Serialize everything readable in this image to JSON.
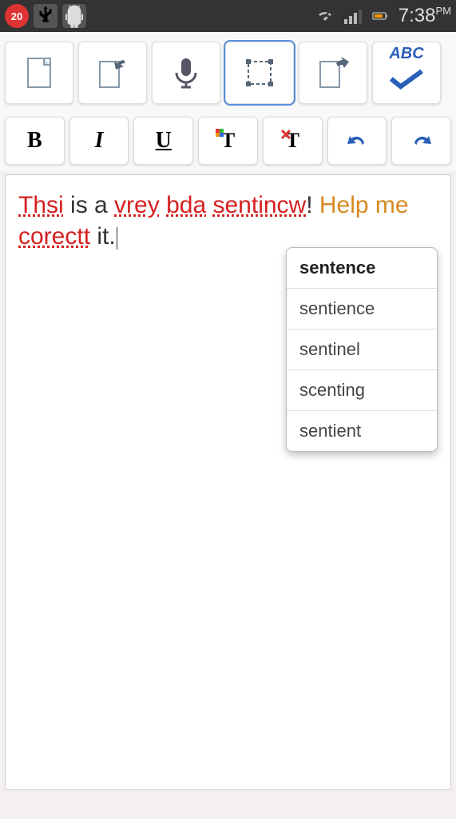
{
  "status_bar": {
    "calendar_day": "20",
    "clock_time": "7:38",
    "clock_ampm": "PM"
  },
  "toolbar1": {
    "new_doc": "new-document",
    "import": "import",
    "voice": "voice-input",
    "select": "selection-mode",
    "export": "export",
    "spellcheck_label": "ABC"
  },
  "toolbar2": {
    "bold": "B",
    "italic": "I",
    "underline": "U",
    "font_color": "T",
    "clear_format": "T",
    "undo": "undo",
    "redo": "redo"
  },
  "document": {
    "segments": [
      {
        "text": "Thsi",
        "cls": "misspell"
      },
      {
        "text": " is a ",
        "cls": ""
      },
      {
        "text": "vrey",
        "cls": "misspell"
      },
      {
        "text": " ",
        "cls": ""
      },
      {
        "text": "bda",
        "cls": "misspell"
      },
      {
        "text": " ",
        "cls": ""
      },
      {
        "text": "sentincw",
        "cls": "misspell"
      },
      {
        "text": "! ",
        "cls": ""
      },
      {
        "text": "Help me ",
        "cls": "grammar"
      },
      {
        "text": "corectt",
        "cls": "misspell"
      },
      {
        "text": " it.",
        "cls": ""
      }
    ]
  },
  "suggestions": [
    {
      "word": "sentence",
      "best": true
    },
    {
      "word": "sentience",
      "best": false
    },
    {
      "word": "sentinel",
      "best": false
    },
    {
      "word": "scenting",
      "best": false
    },
    {
      "word": "sentient",
      "best": false
    }
  ]
}
